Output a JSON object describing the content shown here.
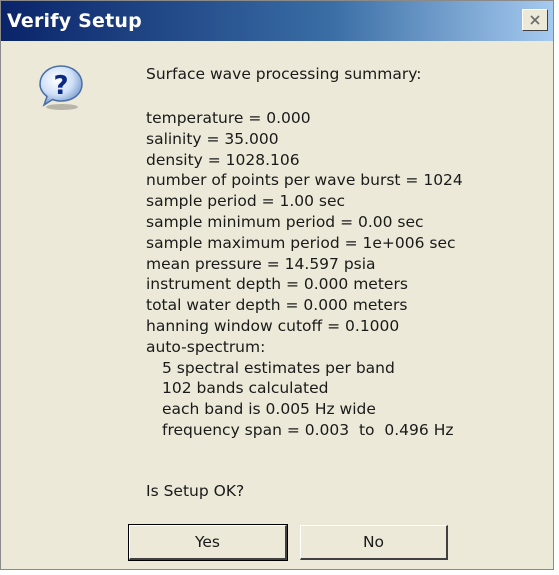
{
  "window": {
    "title": "Verify Setup",
    "close_icon": "close-icon"
  },
  "icon": {
    "name": "question-icon",
    "glyph": "?"
  },
  "summary": {
    "title": "Surface wave processing summary:",
    "lines": [
      "temperature = 0.000",
      "salinity = 35.000",
      "density = 1028.106",
      "number of points per wave burst = 1024",
      "sample period = 1.00 sec",
      "sample minimum period = 0.00 sec",
      "sample maximum period = 1e+006 sec",
      "mean pressure = 14.597 psia",
      "instrument depth = 0.000 meters",
      "total water depth = 0.000 meters",
      "hanning window cutoff = 0.1000",
      "auto-spectrum:"
    ],
    "spectrum_lines": [
      "5 spectral estimates per band",
      "102 bands calculated",
      "each band is 0.005 Hz wide",
      "frequency span = 0.003  to  0.496 Hz"
    ]
  },
  "question": "Is Setup OK?",
  "buttons": {
    "yes": "Yes",
    "no": "No"
  }
}
